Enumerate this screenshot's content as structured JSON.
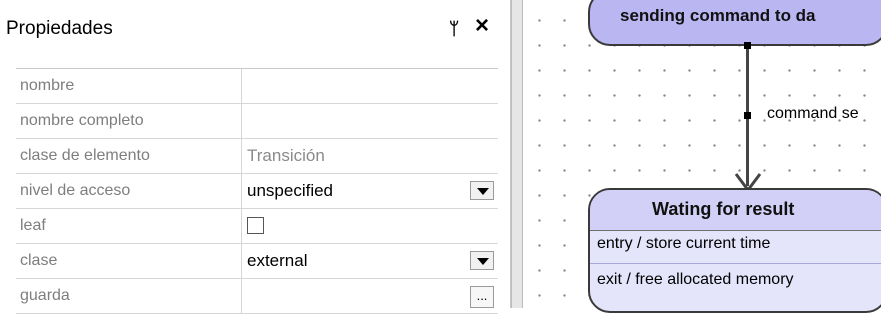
{
  "panel": {
    "title": "Propiedades",
    "pin_glyph": "ᛘ",
    "close_glyph": "×",
    "rows": [
      {
        "name": "nombre",
        "value": ""
      },
      {
        "name": "nombre completo",
        "value": ""
      },
      {
        "name": "clase de elemento",
        "value": "Transición"
      },
      {
        "name": "nivel de acceso",
        "value": "unspecified"
      },
      {
        "name": "leaf",
        "value": ""
      },
      {
        "name": "clase",
        "value": "external"
      },
      {
        "name": "guarda",
        "value": "",
        "button": "..."
      }
    ]
  },
  "diagram": {
    "top_state_label": "sending command to da",
    "transition_label": "command se",
    "bottom_state": {
      "title": "Wating for result",
      "activities": [
        "entry / store current time",
        "exit / free allocated memory"
      ]
    }
  },
  "colors": {
    "state_fill": "#b9b6f1",
    "state_light": "#e4e4fb",
    "grid_border": "#d6d6d6"
  }
}
